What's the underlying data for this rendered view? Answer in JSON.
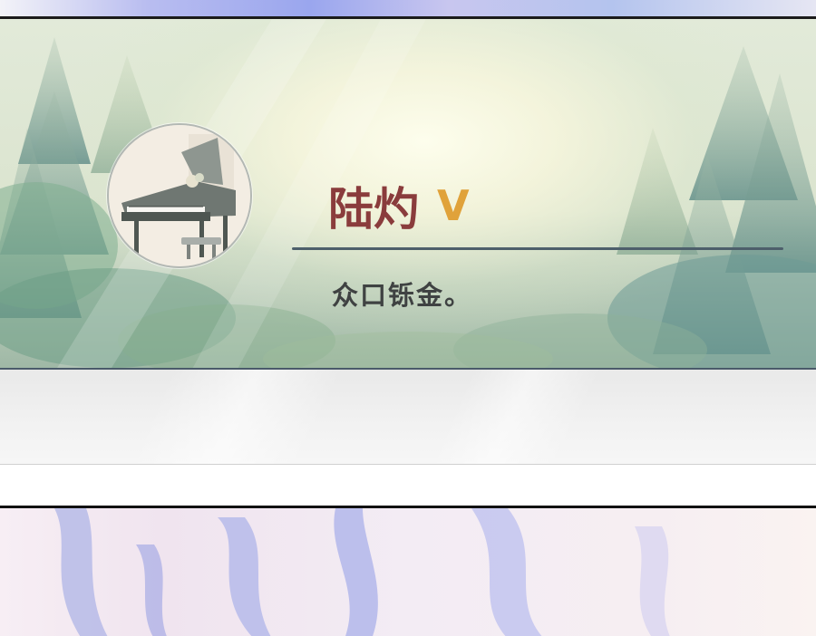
{
  "profile": {
    "name": "陆灼",
    "vip_badge": "V",
    "bio": "众口铄金。",
    "avatar_subject": "piano"
  },
  "colors": {
    "name": "#8a3c3c",
    "vip": "#e0a23a",
    "bio": "#3f4242",
    "divider": "#4d5f6b",
    "panel_border": "#1b1b1b"
  }
}
